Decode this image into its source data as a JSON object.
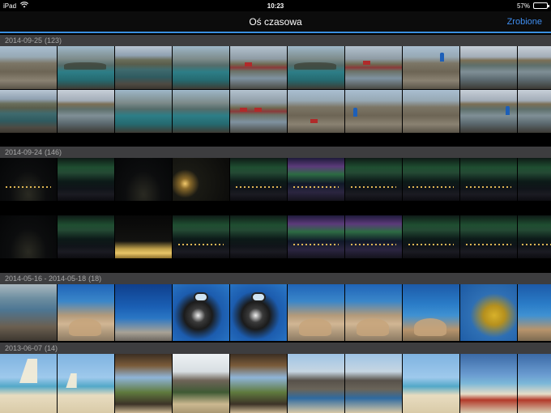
{
  "status_bar": {
    "device": "iPad",
    "wifi_icon": "wifi-icon",
    "time": "10:23",
    "battery": "57%",
    "battery_level": 0.57
  },
  "nav": {
    "title": "Oś czasowa",
    "action_label": "Zrobione"
  },
  "sections": [
    {
      "label": "2014-09-25",
      "count": "(123)"
    },
    {
      "label": "2014-09-24",
      "count": "(146)"
    },
    {
      "label": "2014-05-16 - 2014-05-18",
      "count": "(18)"
    },
    {
      "label": "2013-06-07",
      "count": "(14)"
    }
  ]
}
